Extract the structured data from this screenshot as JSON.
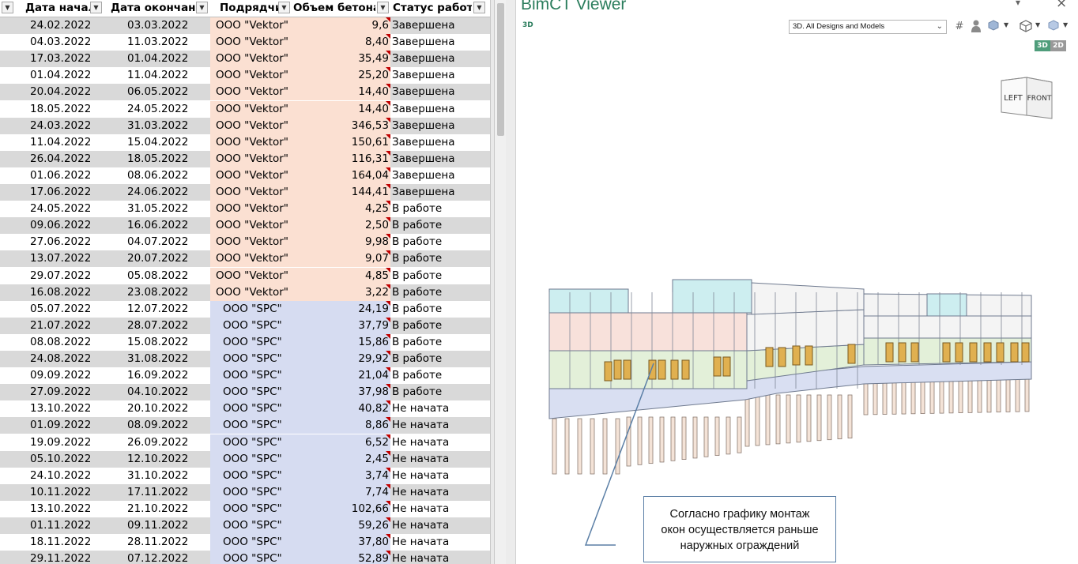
{
  "spreadsheet": {
    "headers": {
      "start": "Дата начал",
      "end": "Дата окончани",
      "contractor": "Подрядчи",
      "volume": "Объем бетона",
      "status": "Статус работ"
    },
    "rows": [
      {
        "start": "24.02.2022",
        "end": "03.03.2022",
        "contractor": "ООО \"Vektor\"",
        "volume": "9,6",
        "status": "Завершена"
      },
      {
        "start": "04.03.2022",
        "end": "11.03.2022",
        "contractor": "ООО \"Vektor\"",
        "volume": "8,40",
        "status": "Завершена"
      },
      {
        "start": "17.03.2022",
        "end": "01.04.2022",
        "contractor": "ООО \"Vektor\"",
        "volume": "35,49",
        "status": "Завершена"
      },
      {
        "start": "01.04.2022",
        "end": "11.04.2022",
        "contractor": "ООО \"Vektor\"",
        "volume": "25,20",
        "status": "Завершена"
      },
      {
        "start": "20.04.2022",
        "end": "06.05.2022",
        "contractor": "ООО \"Vektor\"",
        "volume": "14,40",
        "status": "Завершена"
      },
      {
        "start": "18.05.2022",
        "end": "24.05.2022",
        "contractor": "ООО \"Vektor\"",
        "volume": "14,40",
        "status": "Завершена"
      },
      {
        "start": "24.03.2022",
        "end": "31.03.2022",
        "contractor": "ООО \"Vektor\"",
        "volume": "346,53",
        "status": "Завершена"
      },
      {
        "start": "11.04.2022",
        "end": "15.04.2022",
        "contractor": "ООО \"Vektor\"",
        "volume": "150,61",
        "status": "Завершена"
      },
      {
        "start": "26.04.2022",
        "end": "18.05.2022",
        "contractor": "ООО \"Vektor\"",
        "volume": "116,31",
        "status": "Завершена"
      },
      {
        "start": "01.06.2022",
        "end": "08.06.2022",
        "contractor": "ООО \"Vektor\"",
        "volume": "164,04",
        "status": "Завершена"
      },
      {
        "start": "17.06.2022",
        "end": "24.06.2022",
        "contractor": "ООО \"Vektor\"",
        "volume": "144,41",
        "status": "Завершена"
      },
      {
        "start": "24.05.2022",
        "end": "31.05.2022",
        "contractor": "ООО \"Vektor\"",
        "volume": "4,25",
        "status": "В работе"
      },
      {
        "start": "09.06.2022",
        "end": "16.06.2022",
        "contractor": "ООО \"Vektor\"",
        "volume": "2,50",
        "status": "В работе"
      },
      {
        "start": "27.06.2022",
        "end": "04.07.2022",
        "contractor": "ООО \"Vektor\"",
        "volume": "9,98",
        "status": "В работе"
      },
      {
        "start": "13.07.2022",
        "end": "20.07.2022",
        "contractor": "ООО \"Vektor\"",
        "volume": "9,07",
        "status": "В работе"
      },
      {
        "start": "29.07.2022",
        "end": "05.08.2022",
        "contractor": "ООО \"Vektor\"",
        "volume": "4,85",
        "status": "В работе"
      },
      {
        "start": "16.08.2022",
        "end": "23.08.2022",
        "contractor": "ООО \"Vektor\"",
        "volume": "3,22",
        "status": "В работе"
      },
      {
        "start": "05.07.2022",
        "end": "12.07.2022",
        "contractor": "ООО \"SPC\"",
        "volume": "24,19",
        "status": "В работе"
      },
      {
        "start": "21.07.2022",
        "end": "28.07.2022",
        "contractor": "ООО \"SPC\"",
        "volume": "37,79",
        "status": "В работе"
      },
      {
        "start": "08.08.2022",
        "end": "15.08.2022",
        "contractor": "ООО \"SPC\"",
        "volume": "15,86",
        "status": "В работе"
      },
      {
        "start": "24.08.2022",
        "end": "31.08.2022",
        "contractor": "ООО \"SPC\"",
        "volume": "29,92",
        "status": "В работе"
      },
      {
        "start": "09.09.2022",
        "end": "16.09.2022",
        "contractor": "ООО \"SPC\"",
        "volume": "21,04",
        "status": "В работе"
      },
      {
        "start": "27.09.2022",
        "end": "04.10.2022",
        "contractor": "ООО \"SPC\"",
        "volume": "37,98",
        "status": "В работе"
      },
      {
        "start": "13.10.2022",
        "end": "20.10.2022",
        "contractor": "ООО \"SPC\"",
        "volume": "40,82",
        "status": "Не начата"
      },
      {
        "start": "01.09.2022",
        "end": "08.09.2022",
        "contractor": "ООО \"SPC\"",
        "volume": "8,86",
        "status": "Не начата"
      },
      {
        "start": "19.09.2022",
        "end": "26.09.2022",
        "contractor": "ООО \"SPC\"",
        "volume": "6,52",
        "status": "Не начата"
      },
      {
        "start": "05.10.2022",
        "end": "12.10.2022",
        "contractor": "ООО \"SPC\"",
        "volume": "2,45",
        "status": "Не начата"
      },
      {
        "start": "24.10.2022",
        "end": "31.10.2022",
        "contractor": "ООО \"SPC\"",
        "volume": "3,74",
        "status": "Не начата"
      },
      {
        "start": "10.11.2022",
        "end": "17.11.2022",
        "contractor": "ООО \"SPC\"",
        "volume": "7,74",
        "status": "Не начата"
      },
      {
        "start": "13.10.2022",
        "end": "21.10.2022",
        "contractor": "ООО \"SPC\"",
        "volume": "102,66",
        "status": "Не начата"
      },
      {
        "start": "01.11.2022",
        "end": "09.11.2022",
        "contractor": "ООО \"SPC\"",
        "volume": "59,26",
        "status": "Не начата"
      },
      {
        "start": "18.11.2022",
        "end": "28.11.2022",
        "contractor": "ООО \"SPC\"",
        "volume": "37,80",
        "status": "Не начата"
      },
      {
        "start": "29.11.2022",
        "end": "07.12.2022",
        "contractor": "ООО \"SPC\"",
        "volume": "52,89",
        "status": "Не начата"
      }
    ]
  },
  "viewer": {
    "title": "BimCT Viewer",
    "mode_label": "3D",
    "view_select": "3D. All Designs and Models",
    "toggle_3d": "3D",
    "toggle_2d": "2D",
    "cube_left": "LEFT",
    "cube_front": "FRONT",
    "callout_lines": [
      "Согласно графику монтаж",
      "окон осуществляется раньше",
      "наружных ограждений"
    ]
  },
  "colors": {
    "vektor_fill": "#fbe0d2",
    "spc_fill": "#d6dcf1",
    "row_alt": "#d9d9d9",
    "title_green": "#2b7d5d",
    "comment_mark": "#c00000"
  },
  "icons": [
    "filter-icon",
    "grid-icon",
    "person-icon",
    "box-icon",
    "cube-icon",
    "close-icon",
    "chevron-down-icon"
  ]
}
